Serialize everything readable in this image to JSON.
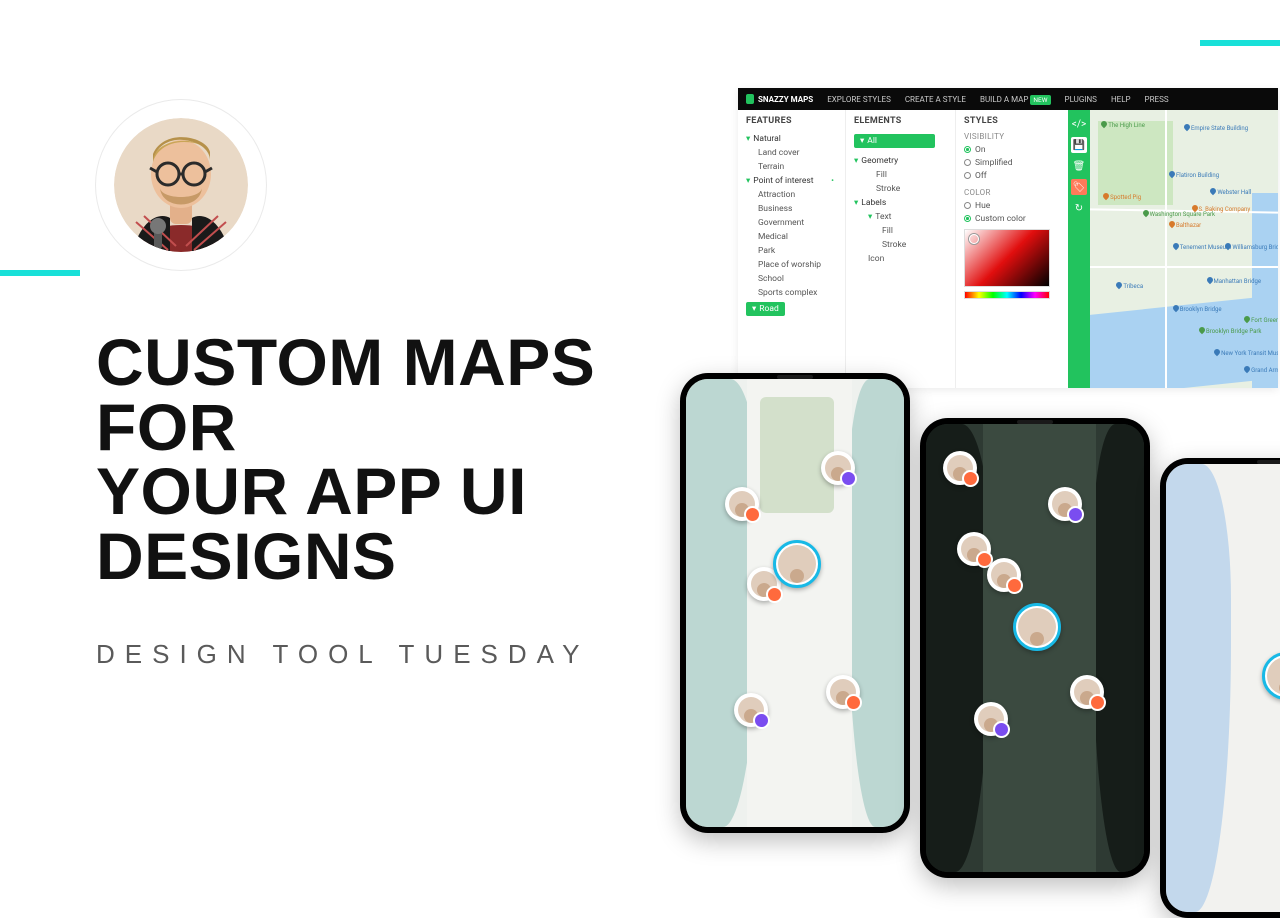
{
  "headline_line1": "CUSTOM MAPS FOR",
  "headline_line2": "YOUR APP UI DESIGNS",
  "subtitle": "DESIGN TOOL TUESDAY",
  "editor": {
    "brand": "SNAZZY MAPS",
    "nav": {
      "explore": "EXPLORE STYLES",
      "create": "CREATE A STYLE",
      "build": "BUILD A MAP",
      "build_badge": "NEW",
      "plugins": "PLUGINS",
      "help": "HELP",
      "press": "PRESS"
    },
    "panels": {
      "features_title": "FEATURES",
      "elements_title": "ELEMENTS",
      "styles_title": "STYLES"
    },
    "features": {
      "natural": "Natural",
      "land_cover": "Land cover",
      "terrain": "Terrain",
      "poi": "Point of interest",
      "attraction": "Attraction",
      "business": "Business",
      "government": "Government",
      "medical": "Medical",
      "park": "Park",
      "place_of_worship": "Place of worship",
      "school": "School",
      "sports_complex": "Sports complex",
      "road": "Road"
    },
    "elements": {
      "all": "All",
      "geometry": "Geometry",
      "fill": "Fill",
      "stroke": "Stroke",
      "labels": "Labels",
      "text": "Text",
      "icon": "Icon"
    },
    "styles": {
      "visibility": "VISIBILITY",
      "on": "On",
      "simplified": "Simplified",
      "off": "Off",
      "color": "COLOR",
      "hue": "Hue",
      "custom_color": "Custom color"
    },
    "map_labels": {
      "highline": "The High Line",
      "empire": "Empire State Building",
      "flatiron": "Flatiron Building",
      "webster": "Webster Hall",
      "washington": "Washington Square Park",
      "baking": "S. Baking Company",
      "balthazar": "Balthazar",
      "piggy": "Spotted Pig",
      "tenement": "Tenement Museum",
      "williamsburg": "Williamsburg Brid",
      "manhattan": "Manhattan Bridge",
      "brooklyn_bridge": "Brooklyn Bridge",
      "brooklyn_park": "Brooklyn Bridge Park",
      "fort_greene": "Fort Greene Park",
      "transit": "New York Transit Museum",
      "grand_army": "Grand Army Plaza",
      "tribeca": "Tribeca"
    },
    "colors": {
      "brand_green": "#22c35e",
      "accent_cyan": "#18e0d8"
    }
  }
}
